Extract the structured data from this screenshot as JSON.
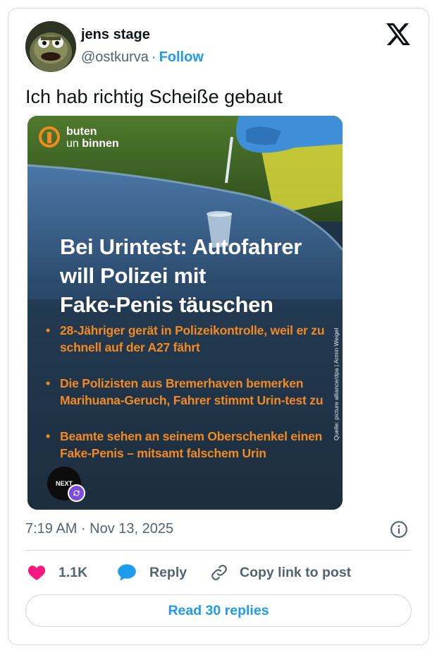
{
  "author": {
    "display_name": "jens stage",
    "handle": "@ostkurva",
    "separator": "·",
    "follow_label": "Follow",
    "avatar_icon": "muppet-avatar"
  },
  "platform_icon": "x-logo-icon",
  "tweet": {
    "text": "Ich hab richtig Scheiße gebaut"
  },
  "media": {
    "brand_line1": "buten",
    "brand_line2_a": "un",
    "brand_line2_b": "binnen",
    "headline_lines": [
      "Bei Urintest: Autofahrer",
      "will Polizei mit",
      "Fake-Penis täuschen"
    ],
    "bullets": [
      "28-Jähriger gerät in Polizeikontrolle, weil er zu schnell auf der A27 fährt",
      "Die Polizisten aus Bremerhaven bemerken Marihuana-Geruch, Fahrer stimmt Urin-test zu",
      "Beamte sehen an seinem Oberschenkel einen Fake-Penis – mitsamt falschem Urin"
    ],
    "source": "Quelle: picture alliance/dpa | Armin Weigel",
    "badge_label": "NEXT",
    "colors": {
      "orange": "#f28a22",
      "navy": "#1f3346"
    }
  },
  "meta": {
    "timestamp": "7:19 AM · Nov 13, 2025"
  },
  "actions": {
    "like_count": "1.1K",
    "reply_label": "Reply",
    "copy_label": "Copy link to post"
  },
  "read_replies_label": "Read 30 replies",
  "colors": {
    "accent": "#1d9bf0",
    "like": "#f91880",
    "secondary_text": "#536471",
    "border": "#cfd9de"
  }
}
